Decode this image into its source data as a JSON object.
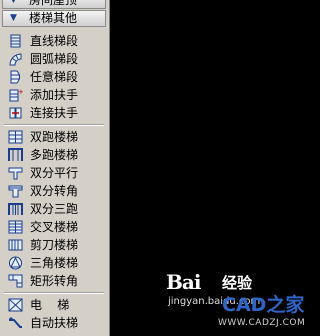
{
  "panel": {
    "top_partial": {
      "label": "房间屋顶",
      "icon": "chevron-down-icon"
    },
    "group_header": {
      "label": "楼梯其他",
      "icon": "chevron-down-icon"
    },
    "items": [
      {
        "label": "直线梯段",
        "icon": "straight-stair-icon"
      },
      {
        "label": "圆弧梯段",
        "icon": "arc-stair-icon"
      },
      {
        "label": "任意梯段",
        "icon": "any-stair-icon"
      },
      {
        "label": "添加扶手",
        "icon": "add-handrail-icon"
      },
      {
        "label": "连接扶手",
        "icon": "connect-handrail-icon"
      },
      {
        "label": "双跑楼梯",
        "icon": "double-run-stair-icon"
      },
      {
        "label": "多跑楼梯",
        "icon": "multi-run-stair-icon"
      },
      {
        "label": "双分平行",
        "icon": "double-split-parallel-icon"
      },
      {
        "label": "双分转角",
        "icon": "double-split-corner-icon"
      },
      {
        "label": "双分三跑",
        "icon": "double-split-triple-icon"
      },
      {
        "label": "交叉楼梯",
        "icon": "cross-stair-icon"
      },
      {
        "label": "剪刀楼梯",
        "icon": "scissor-stair-icon"
      },
      {
        "label": "三角楼梯",
        "icon": "triangle-stair-icon"
      },
      {
        "label": "矩形转角",
        "icon": "rect-corner-stair-icon"
      },
      {
        "label": "电    梯",
        "icon": "elevator-icon"
      },
      {
        "label": "自动扶梯",
        "icon": "escalator-icon"
      }
    ]
  },
  "watermark": {
    "baidu": "Bai",
    "jingyan": "经验",
    "url": "jingyan.baidu.com",
    "cad_brand": "CAD之家",
    "cad_url": "WWW.CADZJ.COM"
  }
}
